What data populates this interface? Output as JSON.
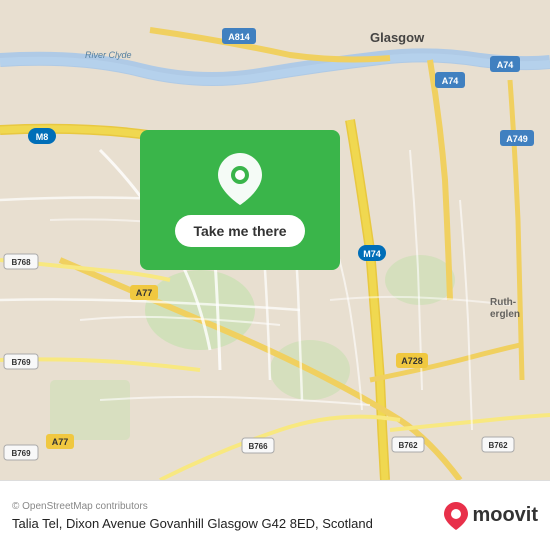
{
  "map": {
    "alt": "Map of Glasgow area showing Govanhill",
    "copyright": "© OpenStreetMap contributors",
    "cta_label": "Take me there",
    "pin_color": "#ffffff",
    "overlay_bg": "#3ab54a"
  },
  "info": {
    "address": "Talia Tel, Dixon Avenue Govanhill Glasgow G42 8ED,",
    "country": "Scotland",
    "moovit": "moovit"
  },
  "road_labels": [
    "Glasgow",
    "River Clyde",
    "A814",
    "A74",
    "A749",
    "M8",
    "M74",
    "B768",
    "A77",
    "B769",
    "B766",
    "B762",
    "A728",
    "Rutherglen"
  ]
}
